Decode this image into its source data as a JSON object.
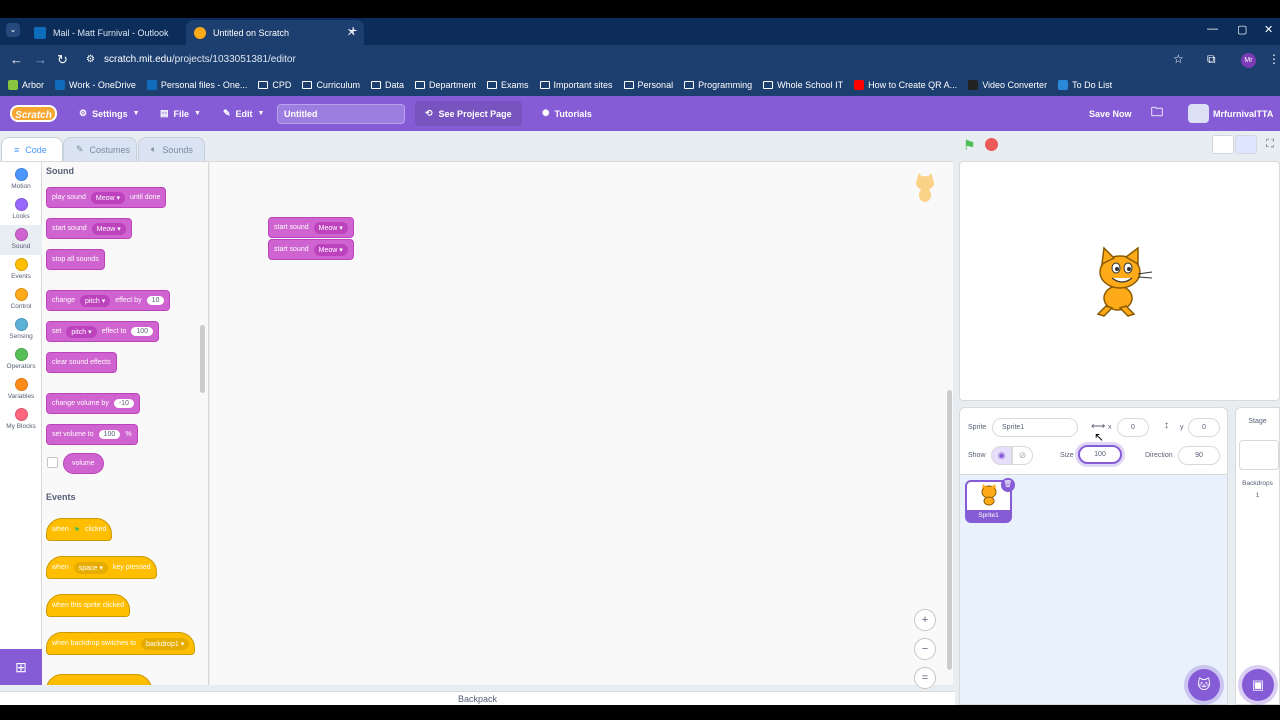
{
  "browser": {
    "tabs": [
      {
        "title": "Mail - Matt Furnival - Outlook",
        "active": false,
        "favicon_color": "#0f6cbd"
      },
      {
        "title": "Untitled on Scratch",
        "active": true,
        "favicon_color": "#ffab19"
      }
    ],
    "url_host": "scratch.mit.edu",
    "url_path": "/projects/1033051381/editor",
    "profile": "Mr",
    "bookmarks": [
      {
        "label": "Arbor",
        "icon": "arbor-icon",
        "color": "#8ac53f"
      },
      {
        "label": "Work - OneDrive",
        "icon": "onedrive-icon",
        "color": "#0f6cbd"
      },
      {
        "label": "Personal files - One...",
        "icon": "onedrive-icon",
        "color": "#0f6cbd"
      },
      {
        "label": "CPD",
        "icon": "folder-icon"
      },
      {
        "label": "Curriculum",
        "icon": "folder-icon"
      },
      {
        "label": "Data",
        "icon": "folder-icon"
      },
      {
        "label": "Department",
        "icon": "folder-icon"
      },
      {
        "label": "Exams",
        "icon": "folder-icon"
      },
      {
        "label": "Important sites",
        "icon": "folder-icon"
      },
      {
        "label": "Personal",
        "icon": "folder-icon"
      },
      {
        "label": "Programming",
        "icon": "folder-icon"
      },
      {
        "label": "Whole School IT",
        "icon": "folder-icon"
      },
      {
        "label": "How to Create QR A...",
        "icon": "youtube-icon",
        "color": "#ff0000"
      },
      {
        "label": "Video Converter",
        "icon": "video-converter-icon",
        "color": "#222222"
      },
      {
        "label": "To Do List",
        "icon": "todo-icon",
        "color": "#2b88d8"
      }
    ]
  },
  "menubar": {
    "logo": "Scratch",
    "settings": "Settings",
    "file": "File",
    "edit": "Edit",
    "project_title": "Untitled",
    "see_project_page": "See Project Page",
    "tutorials": "Tutorials",
    "save_now": "Save Now",
    "username": "MrfurnivalTTA"
  },
  "editor_tabs": {
    "code": "Code",
    "costumes": "Costumes",
    "sounds": "Sounds"
  },
  "categories": [
    {
      "label": "Motion",
      "color": "#4c97ff"
    },
    {
      "label": "Looks",
      "color": "#9966ff"
    },
    {
      "label": "Sound",
      "color": "#cf63cf",
      "selected": true
    },
    {
      "label": "Events",
      "color": "#ffbf00"
    },
    {
      "label": "Control",
      "color": "#ffab19"
    },
    {
      "label": "Sensing",
      "color": "#5cb1d6"
    },
    {
      "label": "Operators",
      "color": "#59c059"
    },
    {
      "label": "Variables",
      "color": "#ff8c1a"
    },
    {
      "label": "My Blocks",
      "color": "#ff6680"
    }
  ],
  "palette": {
    "sound_heading": "Sound",
    "play_sound": {
      "a": "play sound",
      "dd": "Meow",
      "b": "until done"
    },
    "start_sound": {
      "a": "start sound",
      "dd": "Meow"
    },
    "stop_all": "stop all sounds",
    "change_effect": {
      "a": "change",
      "dd": "pitch",
      "b": "effect by",
      "n": "10"
    },
    "set_effect": {
      "a": "set",
      "dd": "pitch",
      "b": "effect to",
      "n": "100"
    },
    "clear_effects": "clear sound effects",
    "change_volume": {
      "a": "change volume by",
      "n": "-10"
    },
    "set_volume": {
      "a": "set volume to",
      "n": "100",
      "b": "%"
    },
    "volume": "volume",
    "events_heading": "Events",
    "when_flag": {
      "a": "when",
      "b": "clicked"
    },
    "when_key": {
      "a": "when",
      "dd": "space",
      "b": "key pressed"
    },
    "when_sprite_clicked": "when this sprite clicked",
    "when_backdrop": {
      "a": "when backdrop switches to",
      "dd": "backdrop1"
    }
  },
  "workspace": {
    "script": [
      {
        "a": "start sound",
        "dd": "Meow"
      },
      {
        "a": "start sound",
        "dd": "Meow"
      }
    ],
    "zoom_in": "+",
    "zoom_out": "−",
    "zoom_reset": "="
  },
  "backpack": "Backpack",
  "sprite_info": {
    "sprite_label": "Sprite",
    "sprite_name": "Sprite1",
    "x_label": "x",
    "x": "0",
    "y_label": "y",
    "y": "0",
    "show_label": "Show",
    "size_label": "Size",
    "size": "100",
    "direction_label": "Direction",
    "direction": "90"
  },
  "sprites": [
    {
      "name": "Sprite1",
      "selected": true
    }
  ],
  "stage_panel": {
    "title": "Stage",
    "backdrops_label": "Backdrops",
    "backdrops_count": "1"
  }
}
